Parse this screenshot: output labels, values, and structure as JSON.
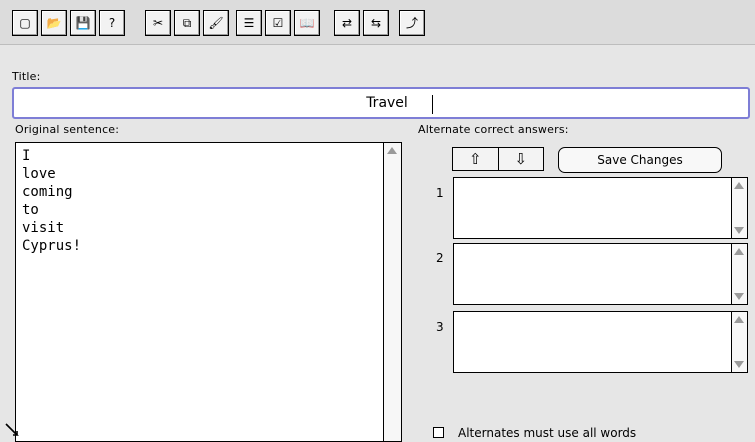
{
  "toolbar": {
    "buttons": [
      {
        "icon": "new-document-icon",
        "glyph": "▢"
      },
      {
        "icon": "open-folder-icon",
        "glyph": "📂"
      },
      {
        "icon": "save-disk-icon",
        "glyph": "💾"
      },
      {
        "icon": "help-icon",
        "glyph": "?"
      },
      {
        "icon": "cut-scissors-icon",
        "glyph": "✂"
      },
      {
        "icon": "copy-icon",
        "glyph": "⧉"
      },
      {
        "icon": "paste-brush-icon",
        "glyph": "🖌"
      },
      {
        "icon": "list-icon",
        "glyph": "☰"
      },
      {
        "icon": "checklist-icon",
        "glyph": "☑"
      },
      {
        "icon": "book-icon",
        "glyph": "📖"
      },
      {
        "icon": "swap-icon",
        "glyph": "⇄"
      },
      {
        "icon": "swap-reverse-icon",
        "glyph": "⇆"
      },
      {
        "icon": "export-icon",
        "glyph": "⤴"
      }
    ]
  },
  "title": {
    "label": "Title:",
    "value": "Travel"
  },
  "original": {
    "label": "Original sentence:",
    "lines": [
      "I",
      "love",
      "coming",
      "to",
      "visit",
      "Cyprus!"
    ]
  },
  "alternates": {
    "label": "Alternate correct answers:",
    "up_glyph": "⇧",
    "down_glyph": "⇩",
    "save_label": "Save Changes",
    "items": [
      {
        "number": "1",
        "value": ""
      },
      {
        "number": "2",
        "value": ""
      },
      {
        "number": "3",
        "value": ""
      }
    ],
    "checkbox_label": "Alternates must use all words"
  }
}
